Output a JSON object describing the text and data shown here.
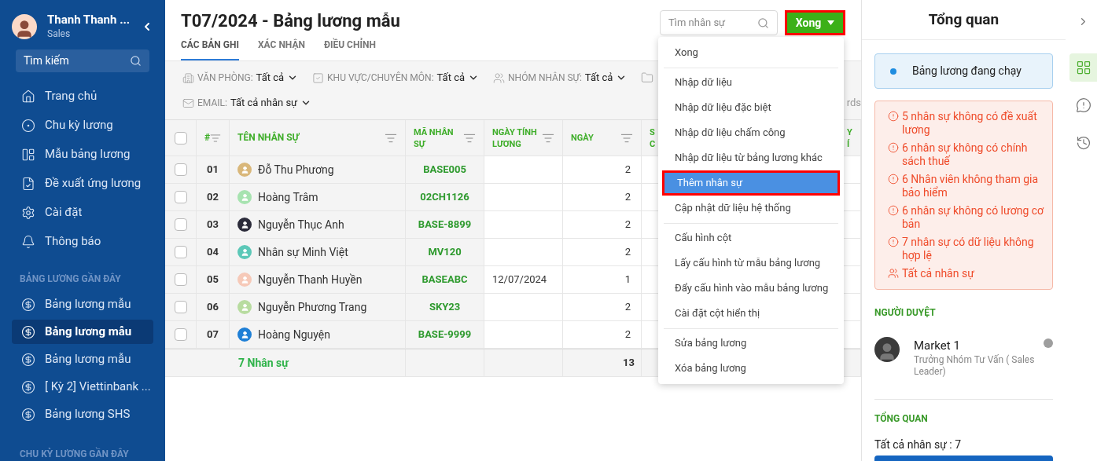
{
  "sidebar": {
    "user": {
      "name": "Thanh Thanh ...",
      "role": "Sales"
    },
    "search": {
      "placeholder": "Tìm kiếm"
    },
    "nav": [
      {
        "label": "Trang chủ",
        "selected": false
      },
      {
        "label": "Chu kỳ lương",
        "selected": false
      },
      {
        "label": "Mẫu bảng lương",
        "selected": false
      },
      {
        "label": "Đề xuất ứng lương",
        "selected": false
      },
      {
        "label": "Cài đặt",
        "selected": false
      },
      {
        "label": "Thông báo",
        "selected": false
      }
    ],
    "recent_title": "BẢNG LƯƠNG GẦN ĐÂY",
    "recent": [
      {
        "label": "Bảng lương mẫu",
        "selected": false
      },
      {
        "label": "Bảng lương mẫu",
        "selected": true
      },
      {
        "label": "Bảng lương mẫu",
        "selected": false
      },
      {
        "label": "[ Kỳ 2] Viettinbank ...",
        "selected": false
      },
      {
        "label": "Bảng lương SHS",
        "selected": false
      }
    ],
    "cycles_title": "CHU KỲ LƯƠNG GẦN ĐÂY"
  },
  "header": {
    "title": "T07/2024 - Bảng lương mẫu",
    "search": {
      "placeholder": "Tìm nhân sự"
    },
    "action_button": {
      "label": "Xong",
      "outlined": true
    }
  },
  "tabs": [
    {
      "label": "CÁC BẢN GHI",
      "selected": true
    },
    {
      "label": "XÁC NHẬN",
      "selected": false
    },
    {
      "label": "ĐIỀU CHỈNH",
      "selected": false
    }
  ],
  "filters": [
    {
      "label": "VĂN PHÒNG:",
      "value": "Tất cả"
    },
    {
      "label": "KHU VỰC/CHUYÊN MÔN:",
      "value": "Tất cả"
    },
    {
      "label": "NHÓM NHÂN SỰ:",
      "value": "Tất cả"
    },
    {
      "label": "EMAIL:",
      "value": "Tất cả nhân sự"
    }
  ],
  "filter_bar_cut_text": "rds",
  "table": {
    "select_all_checked": false,
    "columns": [
      {
        "label": "#"
      },
      {
        "label": "TÊN NHÂN SỰ"
      },
      {
        "label": "MÃ NHÂN SỰ"
      },
      {
        "label": "NGÀY TÍNH LƯƠNG"
      },
      {
        "label": "NGÀY"
      },
      {
        "label": "S C"
      },
      {
        "label": "Y Í"
      }
    ],
    "rows": [
      {
        "checked": false,
        "index": "01",
        "name": "Đỗ Thu Phương",
        "color": "#d9b77a",
        "code": "BASE005",
        "date": "",
        "days": "2"
      },
      {
        "checked": false,
        "index": "02",
        "name": "Hoàng Trâm",
        "color": "#a7e3b0",
        "code": "02CH1126",
        "date": "",
        "days": "2"
      },
      {
        "checked": false,
        "index": "03",
        "name": "Nguyễn Thục Anh",
        "color": "#2b2b3a",
        "code": "BASE-8899",
        "date": "",
        "days": "2"
      },
      {
        "checked": false,
        "index": "04",
        "name": "Nhân sự Minh Việt",
        "color": "#5cc8b8",
        "code": "MV120",
        "date": "",
        "days": "2"
      },
      {
        "checked": false,
        "index": "05",
        "name": "Nguyễn Thanh Huyền",
        "color": "#f6c9b8",
        "code": "BASEABC",
        "date": "12/07/2024",
        "days": "1"
      },
      {
        "checked": false,
        "index": "06",
        "name": "Nguyễn Phương Trang",
        "color": "#b8dca0",
        "code": "SKY23",
        "date": "",
        "days": "2"
      },
      {
        "checked": false,
        "index": "07",
        "name": "Hoàng Nguyện",
        "color": "#1e7fd6",
        "code": "BASE-9999",
        "date": "",
        "days": "2"
      }
    ],
    "footer": {
      "count": "7 Nhân sự",
      "days_total": "13"
    }
  },
  "menu": [
    [
      {
        "label": "Xong",
        "selected": false
      }
    ],
    [
      {
        "label": "Nhập dữ liệu",
        "selected": false
      },
      {
        "label": "Nhập dữ liệu đặc biệt",
        "selected": false
      },
      {
        "label": "Nhập dữ liệu chấm công",
        "selected": false
      },
      {
        "label": "Nhập dữ liệu từ bảng lương khác",
        "selected": false
      },
      {
        "label": "Thêm nhân sự",
        "selected": true
      },
      {
        "label": "Cập nhật dữ liệu hệ thống",
        "selected": false
      }
    ],
    [
      {
        "label": "Cấu hình cột",
        "selected": false
      },
      {
        "label": "Lấy cấu hình từ mẫu bảng lương",
        "selected": false
      },
      {
        "label": "Đẩy cấu hình vào mẫu bảng lương",
        "selected": false
      },
      {
        "label": "Cài đặt cột hiển thị",
        "selected": false
      }
    ],
    [
      {
        "label": "Sửa bảng lương",
        "selected": false
      },
      {
        "label": "Xóa bảng lương",
        "selected": false
      }
    ]
  ],
  "overview": {
    "title": "Tổng quan",
    "status": "Bảng lương đang chạy",
    "warnings": [
      {
        "kind": "warning",
        "text": "5 nhân sự không có đề xuất lương"
      },
      {
        "kind": "warning",
        "text": "6 nhân sự không có chính sách thuế"
      },
      {
        "kind": "warning",
        "text": "6 Nhân viên không tham gia bảo hiểm"
      },
      {
        "kind": "warning",
        "text": "6 nhân sự không có lương cơ bản"
      },
      {
        "kind": "warning",
        "text": "7 nhân sự có dữ liệu không hợp lệ"
      },
      {
        "kind": "people",
        "text": "Tất cả nhân sự"
      }
    ],
    "approvers_title": "NGƯỜI DUYỆT",
    "approver": {
      "name": "Market 1",
      "role": "Trưởng Nhóm Tư Vấn ( Sales Leader)"
    },
    "summary_title": "TỔNG QUAN",
    "summary": "Tất cả nhân sự : 7"
  },
  "rail": [
    {
      "selected": true
    },
    {
      "selected": false
    },
    {
      "selected": false
    }
  ]
}
